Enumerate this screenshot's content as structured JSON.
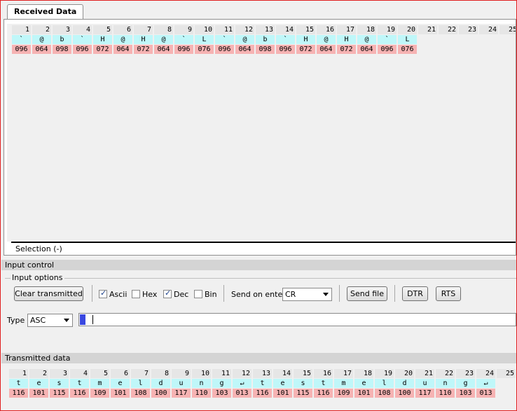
{
  "received": {
    "tab_label": "Received Data",
    "columns": [
      "1",
      "2",
      "3",
      "4",
      "5",
      "6",
      "7",
      "8",
      "9",
      "10",
      "11",
      "12",
      "13",
      "14",
      "15",
      "16",
      "17",
      "18",
      "19",
      "20",
      "21",
      "22",
      "23",
      "24",
      "25"
    ],
    "ascii": [
      "`",
      "@",
      "b",
      "`",
      "H",
      "@",
      "H",
      "@",
      "`",
      "L",
      "`",
      "@",
      "b",
      "`",
      "H",
      "@",
      "H",
      "@",
      "`",
      "L"
    ],
    "dec": [
      "096",
      "064",
      "098",
      "096",
      "072",
      "064",
      "072",
      "064",
      "096",
      "076",
      "096",
      "064",
      "098",
      "096",
      "072",
      "064",
      "072",
      "064",
      "096",
      "076"
    ],
    "selection_label": "Selection (-)"
  },
  "input_control": {
    "header": "Input control",
    "group_title": "Input options",
    "clear_button": "Clear transmitted",
    "ascii_label": "Ascii",
    "hex_label": "Hex",
    "dec_label": "Dec",
    "bin_label": "Bin",
    "ascii_checked": true,
    "hex_checked": false,
    "dec_checked": true,
    "bin_checked": false,
    "send_on_enter_label": "Send on enter",
    "send_on_enter_value": "CR",
    "send_file_button": "Send file",
    "dtr_button": "DTR",
    "rts_button": "RTS",
    "type_label": "Type",
    "type_value": "ASC",
    "input_value": ""
  },
  "transmitted": {
    "header": "Transmitted data",
    "columns": [
      "1",
      "2",
      "3",
      "4",
      "5",
      "6",
      "7",
      "8",
      "9",
      "10",
      "11",
      "12",
      "13",
      "14",
      "15",
      "16",
      "17",
      "18",
      "19",
      "20",
      "21",
      "22",
      "23",
      "24",
      "25"
    ],
    "ascii": [
      "t",
      "e",
      "s",
      "t",
      "m",
      "e",
      "l",
      "d",
      "u",
      "n",
      "g",
      "↵",
      "t",
      "e",
      "s",
      "t",
      "m",
      "e",
      "l",
      "d",
      "u",
      "n",
      "g",
      "↵"
    ],
    "dec": [
      "116",
      "101",
      "115",
      "116",
      "109",
      "101",
      "108",
      "100",
      "117",
      "110",
      "103",
      "013",
      "116",
      "101",
      "115",
      "116",
      "109",
      "101",
      "108",
      "100",
      "117",
      "110",
      "103",
      "013"
    ]
  },
  "colors": {
    "ascii_bg": "#bff7f9",
    "dec_bg": "#f6b3b3",
    "header_bg": "#e6e6e6",
    "frame_border": "#e02020"
  }
}
